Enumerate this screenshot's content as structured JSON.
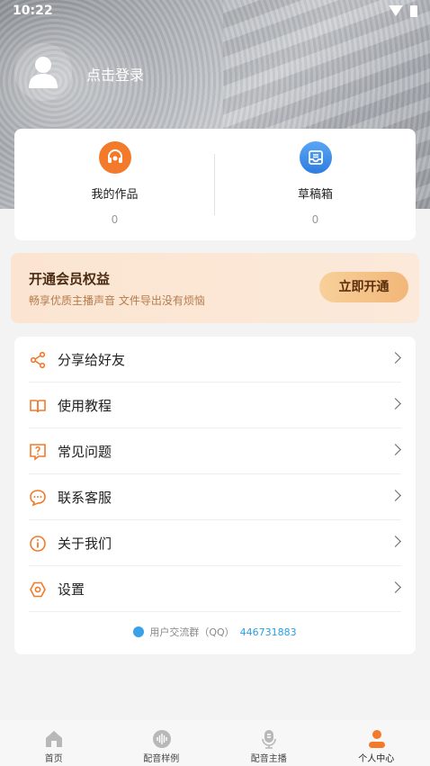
{
  "status_bar": {
    "time": "10:22"
  },
  "profile": {
    "login_text": "点击登录"
  },
  "works": [
    {
      "label": "我的作品",
      "count": "0",
      "icon": "headset-icon"
    },
    {
      "label": "草稿箱",
      "count": "0",
      "icon": "inbox-icon"
    }
  ],
  "vip": {
    "title": "开通会员权益",
    "subtitle": "畅享优质主播声音 文件导出没有烦恼",
    "button": "立即开通"
  },
  "menu": {
    "items": [
      {
        "label": "分享给好友",
        "icon": "share-icon"
      },
      {
        "label": "使用教程",
        "icon": "book-icon"
      },
      {
        "label": "常见问题",
        "icon": "question-icon"
      },
      {
        "label": "联系客服",
        "icon": "chat-icon"
      },
      {
        "label": "关于我们",
        "icon": "info-icon"
      },
      {
        "label": "设置",
        "icon": "gear-icon"
      }
    ],
    "qq_group_label": "用户交流群（QQ）",
    "qq_group_number": "446731883"
  },
  "nav": {
    "items": [
      {
        "label": "首页",
        "icon": "home-icon"
      },
      {
        "label": "配音样例",
        "icon": "audio-wave-icon"
      },
      {
        "label": "配音主播",
        "icon": "microphone-icon"
      },
      {
        "label": "个人中心",
        "icon": "person-icon"
      }
    ],
    "active_index": 3
  },
  "colors": {
    "accent": "#f27a2a",
    "link": "#2b9fe0",
    "vip_text": "#4a2a12"
  }
}
